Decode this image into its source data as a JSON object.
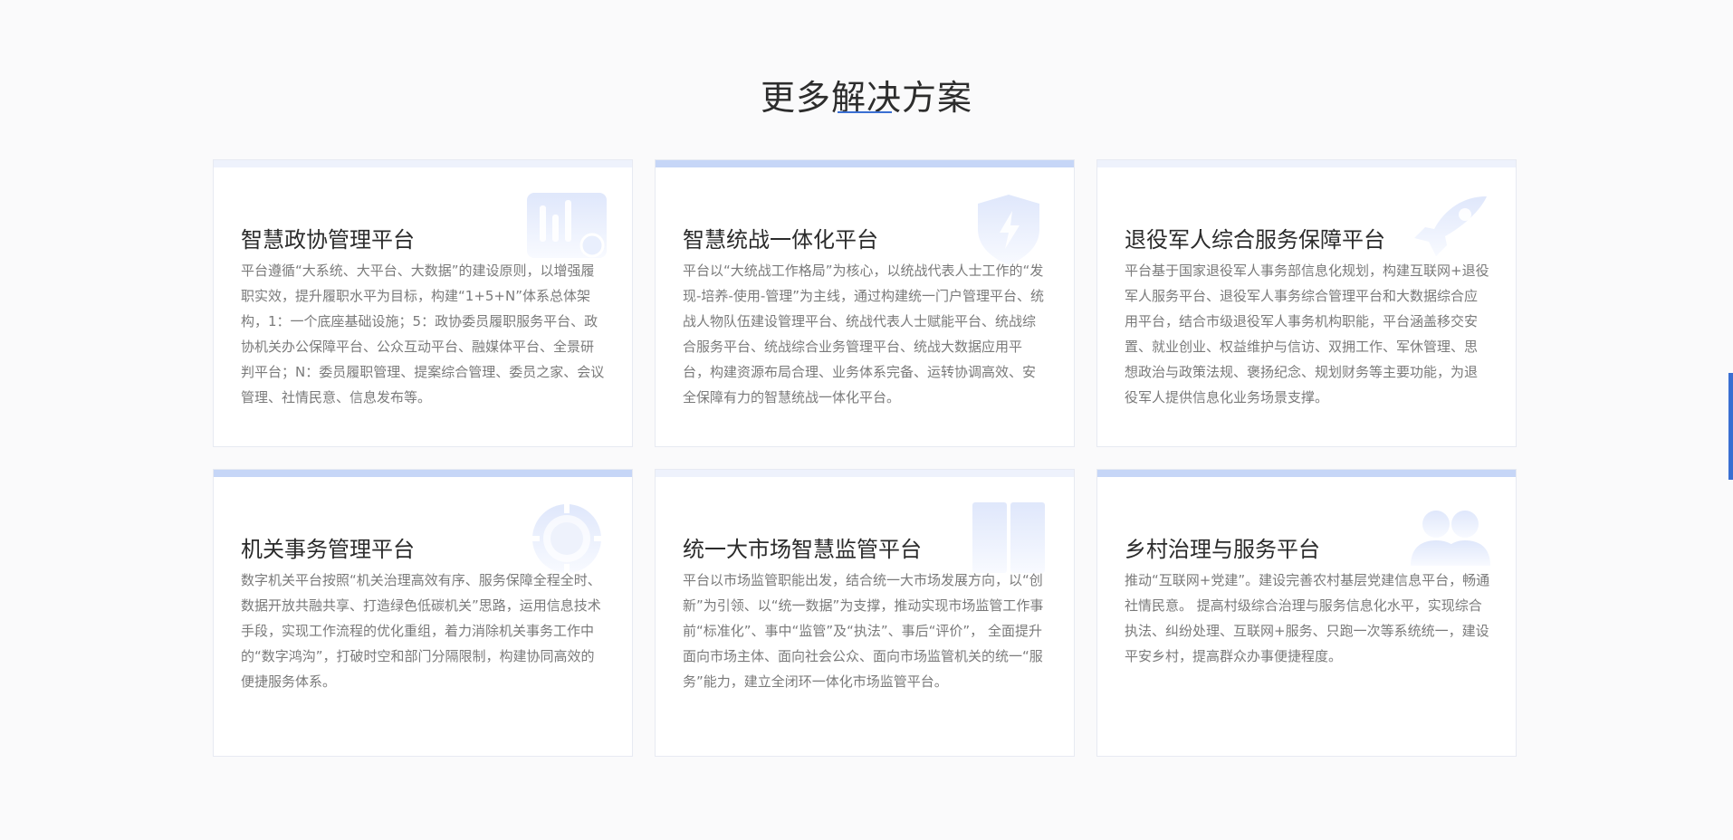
{
  "section": {
    "title": "更多解决方案"
  },
  "colors": {
    "accent": "#3a6fd2",
    "card_bar_light": "#eef2fc",
    "card_bar_accent": "#c6d6f7"
  },
  "cards": [
    {
      "title": "智慧政协管理平台",
      "icon": "chart-board-icon",
      "desc": "平台遵循“大系统、大平台、大数据”的建设原则，以增强履职实效，提升履职水平为目标，构建“1+5+N”体系总体架构，1：一个底座基础设施；5：政协委员履职服务平台、政协机关办公保障平台、公众互动平台、融媒体平台、全景研判平台；N：委员履职管理、提案综合管理、委员之家、会议管理、社情民意、信息发布等。"
    },
    {
      "title": "智慧统战一体化平台",
      "icon": "shield-bolt-icon",
      "desc": "平台以“大统战工作格局”为核心，以统战代表人士工作的“发现-培养-使用-管理”为主线，通过构建统一门户管理平台、统战人物队伍建设管理平台、统战代表人士赋能平台、统战综合服务平台、统战综合业务管理平台、统战大数据应用平台，构建资源布局合理、业务体系完备、运转协调高效、安全保障有力的智慧统战一体化平台。"
    },
    {
      "title": "退役军人综合服务保障平台",
      "icon": "rocket-icon",
      "desc": "平台基于国家退役军人事务部信息化规划，构建互联网+退役军人服务平台、退役军人事务综合管理平台和大数据综合应用平台，结合市级退役军人事务机构职能，平台涵盖移交安置、就业创业、权益维护与信访、双拥工作、军休管理、思想政治与政策法规、褒扬纪念、规划财务等主要功能，为退役军人提供信息化业务场景支撑。"
    },
    {
      "title": "机关事务管理平台",
      "icon": "target-icon",
      "desc": "数字机关平台按照“机关治理高效有序、服务保障全程全时、数据开放共融共享、打造绿色低碳机关”思路，运用信息技术手段，实现工作流程的优化重组，着力消除机关事务工作中的“数字鸿沟”，打破时空和部门分隔限制，构建协同高效的便捷服务体系。"
    },
    {
      "title": "统一大市场智慧监管平台",
      "icon": "book-icon",
      "desc": "平台以市场监管职能出发，结合统一大市场发展方向，以“创新”为引领、以“统一数据”为支撑，推动实现市场监管工作事前“标准化”、事中“监管”及“执法”、事后“评价”， 全面提升面向市场主体、面向社会公众、面向市场监管机关的统一“服务”能力，建立全闭环一体化市场监管平台。"
    },
    {
      "title": "乡村治理与服务平台",
      "icon": "users-icon",
      "desc": "推动“互联网+党建”。建设完善农村基层党建信息平台，畅通社情民意。 提高村级综合治理与服务信息化水平，实现综合执法、纠纷处理、互联网+服务、只跑一次等系统统一，建设平安乡村，提高群众办事便捷程度。"
    }
  ]
}
